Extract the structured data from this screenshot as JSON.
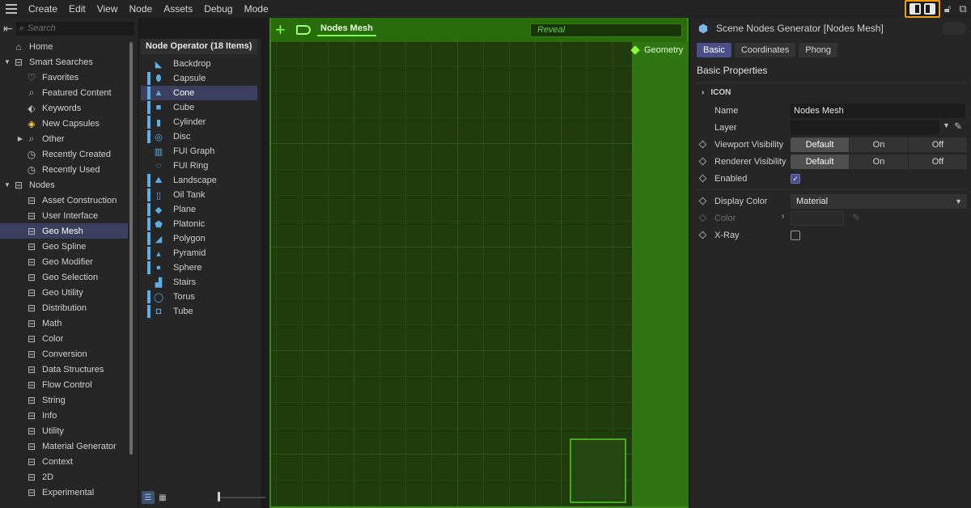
{
  "menubar": {
    "items": [
      "Create",
      "Edit",
      "View",
      "Node",
      "Assets",
      "Debug",
      "Mode"
    ],
    "icons": {
      "menu": "hamburger-icon",
      "layout": "dual-panel-layout-icon",
      "lock": "lock-icon",
      "popout": "popout-window-icon"
    }
  },
  "tree": {
    "search_placeholder": "Search",
    "items": [
      {
        "label": "Home",
        "icon": "home-icon",
        "arrow": "",
        "indent": 0
      },
      {
        "label": "Smart Searches",
        "icon": "folder-icon",
        "arrow": "▼",
        "indent": 0
      },
      {
        "label": "Favorites",
        "icon": "heart-icon",
        "arrow": "",
        "indent": 1
      },
      {
        "label": "Featured Content",
        "icon": "search-icon",
        "arrow": "",
        "indent": 1
      },
      {
        "label": "Keywords",
        "icon": "tag-icon",
        "arrow": "",
        "indent": 1
      },
      {
        "label": "New Capsules",
        "icon": "capsule-search-icon",
        "arrow": "",
        "indent": 1
      },
      {
        "label": "Other",
        "icon": "search-icon",
        "arrow": "▶",
        "indent": 1
      },
      {
        "label": "Recently Created",
        "icon": "clock-icon",
        "arrow": "",
        "indent": 1
      },
      {
        "label": "Recently Used",
        "icon": "clock-icon",
        "arrow": "",
        "indent": 1
      },
      {
        "label": "Nodes",
        "icon": "folder-icon",
        "arrow": "▼",
        "indent": 0
      },
      {
        "label": "Asset Construction",
        "icon": "folder-icon",
        "arrow": "",
        "indent": 1
      },
      {
        "label": "User Interface",
        "icon": "folder-icon",
        "arrow": "",
        "indent": 1
      },
      {
        "label": "Geo Mesh",
        "icon": "folder-icon",
        "arrow": "",
        "indent": 1
      },
      {
        "label": "Geo Spline",
        "icon": "folder-icon",
        "arrow": "",
        "indent": 1
      },
      {
        "label": "Geo Modifier",
        "icon": "folder-icon",
        "arrow": "",
        "indent": 1
      },
      {
        "label": "Geo Selection",
        "icon": "folder-icon",
        "arrow": "",
        "indent": 1
      },
      {
        "label": "Geo Utility",
        "icon": "folder-icon",
        "arrow": "",
        "indent": 1
      },
      {
        "label": "Distribution",
        "icon": "folder-icon",
        "arrow": "",
        "indent": 1
      },
      {
        "label": "Math",
        "icon": "folder-icon",
        "arrow": "",
        "indent": 1
      },
      {
        "label": "Color",
        "icon": "folder-icon",
        "arrow": "",
        "indent": 1
      },
      {
        "label": "Conversion",
        "icon": "folder-icon",
        "arrow": "",
        "indent": 1
      },
      {
        "label": "Data Structures",
        "icon": "folder-icon",
        "arrow": "",
        "indent": 1
      },
      {
        "label": "Flow Control",
        "icon": "folder-icon",
        "arrow": "",
        "indent": 1
      },
      {
        "label": "String",
        "icon": "folder-icon",
        "arrow": "",
        "indent": 1
      },
      {
        "label": "Info",
        "icon": "folder-icon",
        "arrow": "",
        "indent": 1
      },
      {
        "label": "Utility",
        "icon": "folder-icon",
        "arrow": "",
        "indent": 1
      },
      {
        "label": "Material Generator",
        "icon": "folder-icon",
        "arrow": "",
        "indent": 1
      },
      {
        "label": "Context",
        "icon": "folder-icon",
        "arrow": "",
        "indent": 1
      },
      {
        "label": "2D",
        "icon": "folder-icon",
        "arrow": "",
        "indent": 1
      },
      {
        "label": "Experimental",
        "icon": "folder-icon",
        "arrow": "",
        "indent": 1
      }
    ],
    "selected": "Geo Mesh"
  },
  "operators": {
    "header": "Node Operator (18 Items)",
    "items": [
      {
        "label": "Backdrop",
        "icon": "backdrop-icon",
        "bar": false
      },
      {
        "label": "Capsule",
        "icon": "capsule-icon",
        "bar": true
      },
      {
        "label": "Cone",
        "icon": "cone-icon",
        "bar": true
      },
      {
        "label": "Cube",
        "icon": "cube-icon",
        "bar": true
      },
      {
        "label": "Cylinder",
        "icon": "cylinder-icon",
        "bar": true
      },
      {
        "label": "Disc",
        "icon": "disc-icon",
        "bar": true
      },
      {
        "label": "FUI Graph",
        "icon": "fui-graph-icon",
        "bar": false
      },
      {
        "label": "FUI Ring",
        "icon": "fui-ring-icon",
        "bar": false
      },
      {
        "label": "Landscape",
        "icon": "landscape-icon",
        "bar": true
      },
      {
        "label": "Oil Tank",
        "icon": "oil-tank-icon",
        "bar": true
      },
      {
        "label": "Plane",
        "icon": "plane-icon",
        "bar": true
      },
      {
        "label": "Platonic",
        "icon": "platonic-icon",
        "bar": true
      },
      {
        "label": "Polygon",
        "icon": "polygon-icon",
        "bar": true
      },
      {
        "label": "Pyramid",
        "icon": "pyramid-icon",
        "bar": true
      },
      {
        "label": "Sphere",
        "icon": "sphere-icon",
        "bar": true
      },
      {
        "label": "Stairs",
        "icon": "stairs-icon",
        "bar": false
      },
      {
        "label": "Torus",
        "icon": "torus-icon",
        "bar": true
      },
      {
        "label": "Tube",
        "icon": "tube-icon",
        "bar": true
      }
    ],
    "selected": "Cone"
  },
  "editor": {
    "tab": "Nodes Mesh",
    "reveal_placeholder": "Reveal",
    "port_label": "Geometry",
    "accent": "#7cff4a"
  },
  "attributes": {
    "title": "Scene Nodes Generator [Nodes Mesh]",
    "tabs": [
      "Basic",
      "Coordinates",
      "Phong"
    ],
    "active_tab": "Basic",
    "section": "Basic Properties",
    "group": "ICON",
    "name_label": "Name",
    "name_value": "Nodes Mesh",
    "layer_label": "Layer",
    "viewport_label": "Viewport Visibility",
    "renderer_label": "Renderer Visibility",
    "visibility_options": [
      "Default",
      "On",
      "Off"
    ],
    "enabled_label": "Enabled",
    "enabled": true,
    "display_color_label": "Display Color",
    "display_color_value": "Material",
    "color_label": "Color",
    "xray_label": "X-Ray",
    "xray": false
  }
}
